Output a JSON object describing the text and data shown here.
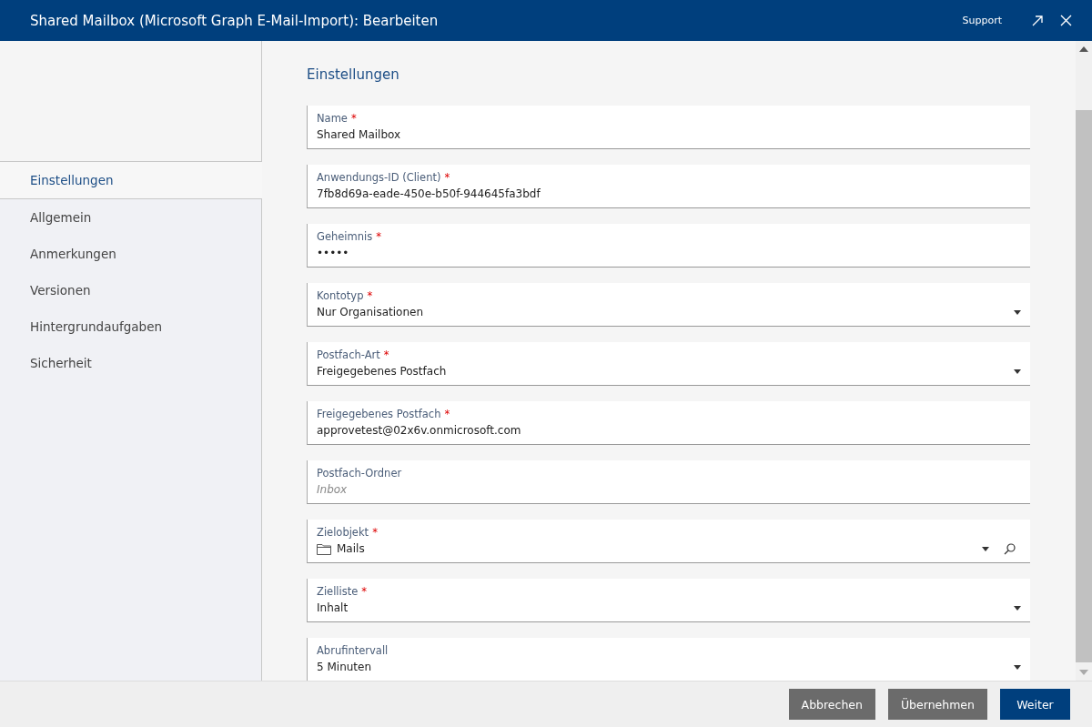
{
  "window": {
    "title": "Shared Mailbox (Microsoft Graph E-Mail-Import): Bearbeiten",
    "support": "Support"
  },
  "sidebar": {
    "items": [
      {
        "label": "Einstellungen",
        "selected": true
      },
      {
        "label": "Allgemein",
        "selected": false
      },
      {
        "label": "Anmerkungen",
        "selected": false
      },
      {
        "label": "Versionen",
        "selected": false
      },
      {
        "label": "Hintergrundaufgaben",
        "selected": false
      },
      {
        "label": "Sicherheit",
        "selected": false
      }
    ]
  },
  "section_title": "Einstellungen",
  "fields": [
    {
      "kind": "text",
      "label": "Name",
      "required_mark": "*",
      "value": "Shared Mailbox"
    },
    {
      "kind": "text",
      "label": "Anwendungs-ID (Client)",
      "required_mark": "*",
      "value": "7fb8d69a-eade-450e-b50f-944645fa3bdf"
    },
    {
      "kind": "password",
      "label": "Geheimnis",
      "required_mark": "*",
      "value": "•••••"
    },
    {
      "kind": "select",
      "label": "Kontotyp",
      "required_mark": "*",
      "value": "Nur Organisationen"
    },
    {
      "kind": "select",
      "label": "Postfach-Art",
      "required_mark": "*",
      "value": "Freigegebenes Postfach"
    },
    {
      "kind": "text",
      "label": "Freigegebenes Postfach",
      "required_mark": "*",
      "value": "approvetest@02x6v.onmicrosoft.com"
    },
    {
      "kind": "text",
      "label": "Postfach-Ordner",
      "placeholder": "Inbox"
    },
    {
      "kind": "lookup",
      "label": "Zielobjekt",
      "required_mark": "*",
      "value": "Mails"
    },
    {
      "kind": "select",
      "label": "Zielliste",
      "required_mark": "*",
      "value": "Inhalt"
    },
    {
      "kind": "select",
      "label": "Abrufintervall",
      "value": "5 Minuten"
    }
  ],
  "buttons": [
    {
      "label": "Abbrechen",
      "kind": "secondary"
    },
    {
      "label": "Übernehmen",
      "kind": "secondary"
    },
    {
      "label": "Weiter",
      "kind": "primary"
    }
  ]
}
